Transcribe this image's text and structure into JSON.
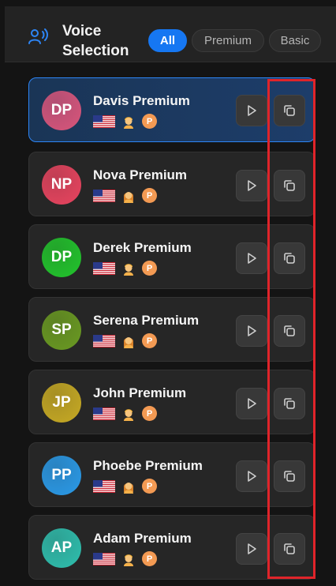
{
  "header": {
    "title": "Voice Selection",
    "filters": [
      {
        "label": "All",
        "active": true
      },
      {
        "label": "Premium",
        "active": false
      },
      {
        "label": "Basic",
        "active": false
      }
    ]
  },
  "voices": [
    {
      "initials": "DP",
      "name": "Davis Premium",
      "avatar_color": "#d9557a",
      "flag": "us-flag",
      "gender_icon": "man-icon",
      "badge": "P",
      "selected": true
    },
    {
      "initials": "NP",
      "name": "Nova Premium",
      "avatar_color": "#e8445f",
      "flag": "us-flag",
      "gender_icon": "woman-icon",
      "badge": "P",
      "selected": false
    },
    {
      "initials": "DP",
      "name": "Derek Premium",
      "avatar_color": "#22c42c",
      "flag": "us-flag",
      "gender_icon": "man-icon",
      "badge": "P",
      "selected": false
    },
    {
      "initials": "SP",
      "name": "Serena Premium",
      "avatar_color": "#6a9a22",
      "flag": "us-flag",
      "gender_icon": "woman-icon",
      "badge": "P",
      "selected": false
    },
    {
      "initials": "JP",
      "name": "John Premium",
      "avatar_color": "#c7aa24",
      "flag": "us-flag",
      "gender_icon": "man-icon",
      "badge": "P",
      "selected": false
    },
    {
      "initials": "PP",
      "name": "Phoebe Premium",
      "avatar_color": "#2a9ae8",
      "flag": "us-flag",
      "gender_icon": "woman-icon",
      "badge": "P",
      "selected": false
    },
    {
      "initials": "AP",
      "name": "Adam Premium",
      "avatar_color": "#2fbfae",
      "flag": "us-flag",
      "gender_icon": "man-icon",
      "badge": "P",
      "selected": false
    }
  ],
  "icons": {
    "header": "voice-icon",
    "play": "play-icon",
    "copy": "copy-icon"
  },
  "colors": {
    "accent": "#1677f2",
    "highlight": "#e0242a",
    "premium_badge": "#f39a53"
  }
}
